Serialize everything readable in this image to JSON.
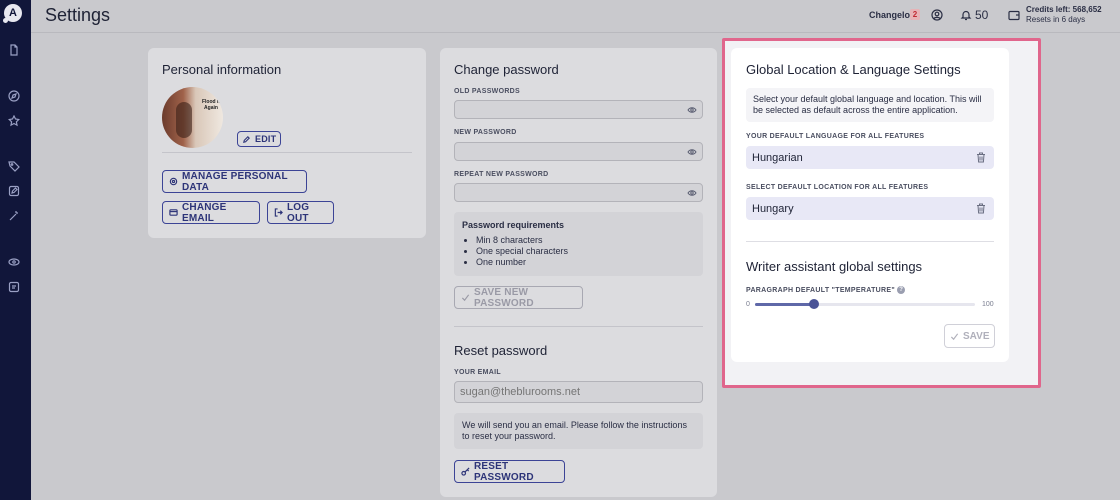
{
  "header": {
    "title": "Settings",
    "changelog_label": "Changelog",
    "changelog_count": "2",
    "notifications_count": "50",
    "credits_label": "Credits left: 568,652",
    "credits_reset": "Resets in 6 days"
  },
  "sidebar": {
    "logo": "A",
    "icons": [
      "document-icon",
      "compass-icon",
      "star-icon",
      "tag-icon",
      "edit-icon",
      "wand-icon",
      "link-icon",
      "chat-icon"
    ]
  },
  "personal": {
    "title": "Personal information",
    "avatar_text": "Flood it Again",
    "edit_label": "EDIT",
    "manage_label": "MANAGE PERSONAL DATA",
    "change_email_label": "CHANGE EMAIL",
    "logout_label": "LOG OUT"
  },
  "password": {
    "title": "Change password",
    "old_label": "OLD PASSWORDS",
    "new_label": "NEW PASSWORD",
    "repeat_label": "REPEAT NEW PASSWORD",
    "req_title": "Password requirements",
    "req_items": [
      "Min 8 characters",
      "One special characters",
      "One number"
    ],
    "save_label": "SAVE NEW PASSWORD"
  },
  "reset": {
    "title": "Reset password",
    "email_label": "YOUR EMAIL",
    "email_placeholder": "sugan@theblurooms.net",
    "info": "We will send you an email. Please follow the instructions to reset your password.",
    "button_label": "RESET PASSWORD"
  },
  "global": {
    "title": "Global Location & Language Settings",
    "description": "Select your default global language and location. This will be selected as default across the entire application.",
    "language_label": "YOUR DEFAULT LANGUAGE FOR ALL FEATURES",
    "language_value": "Hungarian",
    "location_label": "SELECT DEFAULT LOCATION FOR ALL FEATURES",
    "location_value": "Hungary"
  },
  "writer": {
    "title": "Writer assistant global settings",
    "temperature_label": "PARAGRAPH DEFAULT \"TEMPERATURE\"",
    "temperature_min": "0",
    "temperature_max": "100",
    "temperature_value": 27,
    "save_label": "SAVE"
  },
  "colors": {
    "sidebar": "#11163a",
    "accent": "#3c4496",
    "highlight_border": "#e0668c",
    "badge": "#c22a34"
  }
}
